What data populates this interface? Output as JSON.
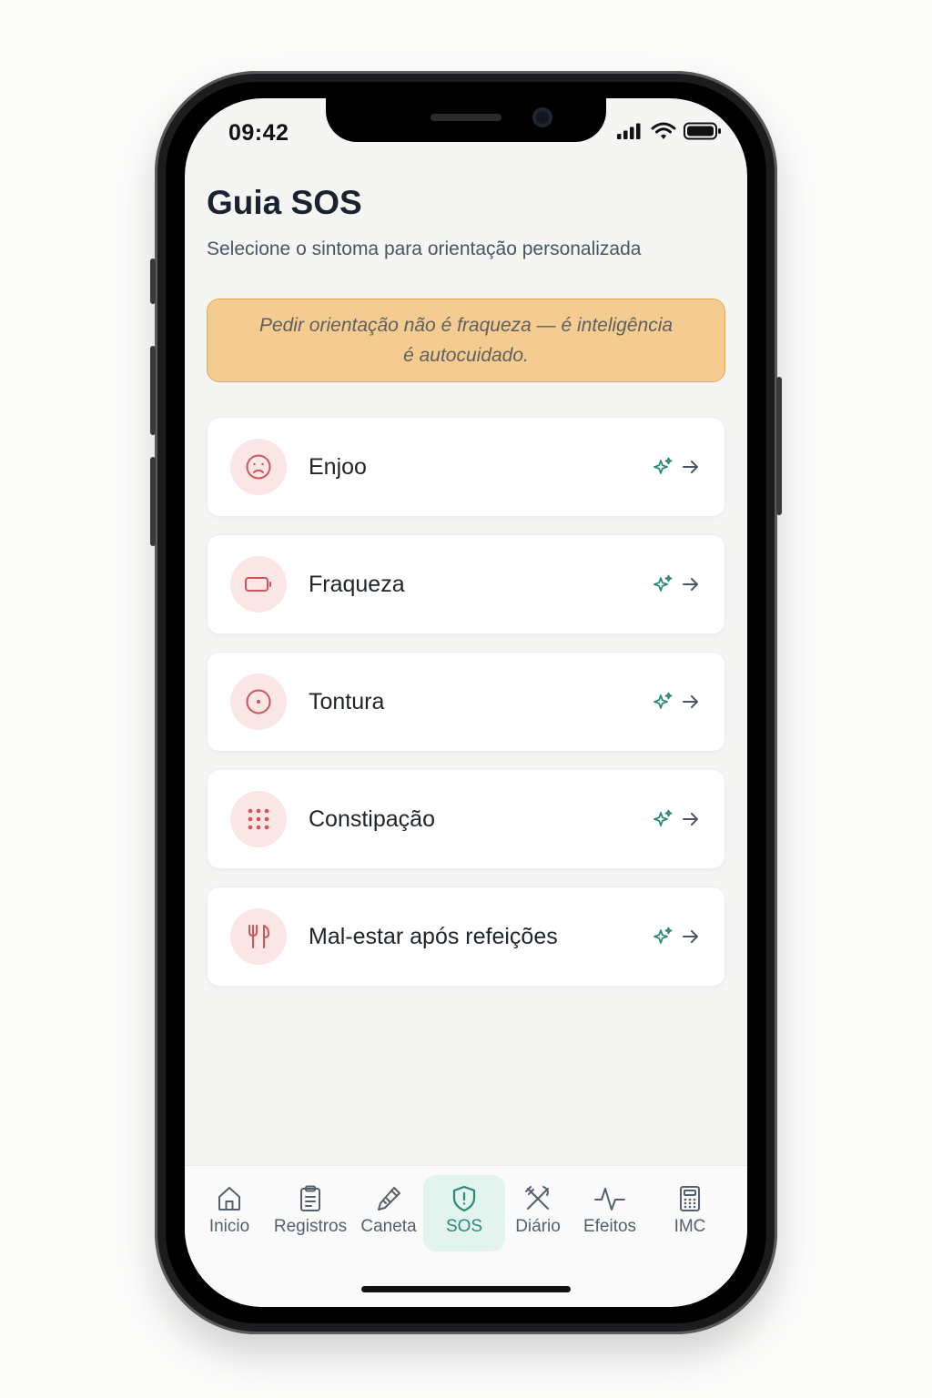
{
  "status_bar": {
    "time": "09:42"
  },
  "header": {
    "title": "Guia SOS",
    "subtitle": "Selecione o sintoma para orientação personalizada"
  },
  "banner": {
    "line1": "Pedir orientação não é fraqueza — é inteligência",
    "line2": "é autocuidado."
  },
  "symptoms": [
    {
      "label": "Enjoo",
      "icon": "frown-face-icon"
    },
    {
      "label": "Fraqueza",
      "icon": "low-battery-icon"
    },
    {
      "label": "Tontura",
      "icon": "target-circle-icon"
    },
    {
      "label": "Constipação",
      "icon": "dots-grid-icon"
    },
    {
      "label": "Mal-estar após refeições",
      "icon": "fork-knife-icon"
    }
  ],
  "tabs": [
    {
      "label": "Inicio",
      "icon": "home-icon"
    },
    {
      "label": "Registros",
      "icon": "clipboard-icon"
    },
    {
      "label": "Caneta",
      "icon": "pen-icon"
    },
    {
      "label": "SOS",
      "icon": "shield-alert-icon",
      "active": true
    },
    {
      "label": "Diário",
      "icon": "utensils-cross-icon"
    },
    {
      "label": "Efeitos",
      "icon": "pulse-icon"
    },
    {
      "label": "IMC",
      "icon": "calculator-icon"
    }
  ],
  "colors": {
    "accent": "#2a8a76",
    "banner_bg": "#f4cc92",
    "banner_border": "#e8a854",
    "symptom_icon": "#d0545a",
    "symptom_icon_bg": "#fbe6e6"
  }
}
